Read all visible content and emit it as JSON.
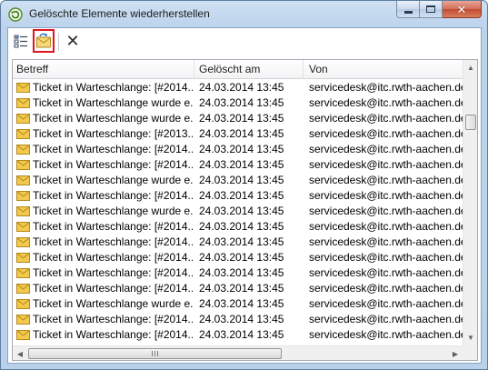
{
  "window": {
    "title": "Gelöschte Elemente wiederherstellen",
    "close_symbol": "✕"
  },
  "toolbar": {
    "select_icon": "select-all-icon",
    "restore_icon": "envelope-restore-icon",
    "delete_symbol": "✕"
  },
  "columns": [
    "Betreff",
    "Gelöscht am",
    "Von"
  ],
  "rows": [
    {
      "subject": "Ticket in Warteschlange: [#2014...",
      "deleted": "24.03.2014 13:45",
      "from": "servicedesk@itc.rwth-aachen.de"
    },
    {
      "subject": "Ticket in Warteschlange wurde e...",
      "deleted": "24.03.2014 13:45",
      "from": "servicedesk@itc.rwth-aachen.de"
    },
    {
      "subject": "Ticket in Warteschlange wurde e...",
      "deleted": "24.03.2014 13:45",
      "from": "servicedesk@itc.rwth-aachen.de"
    },
    {
      "subject": "Ticket in Warteschlange: [#2013...",
      "deleted": "24.03.2014 13:45",
      "from": "servicedesk@itc.rwth-aachen.de"
    },
    {
      "subject": "Ticket in Warteschlange: [#2014...",
      "deleted": "24.03.2014 13:45",
      "from": "servicedesk@itc.rwth-aachen.de"
    },
    {
      "subject": "Ticket in Warteschlange: [#2014...",
      "deleted": "24.03.2014 13:45",
      "from": "servicedesk@itc.rwth-aachen.de"
    },
    {
      "subject": "Ticket in Warteschlange wurde e...",
      "deleted": "24.03.2014 13:45",
      "from": "servicedesk@itc.rwth-aachen.de"
    },
    {
      "subject": "Ticket in Warteschlange: [#2014...",
      "deleted": "24.03.2014 13:45",
      "from": "servicedesk@itc.rwth-aachen.de"
    },
    {
      "subject": "Ticket in Warteschlange wurde e...",
      "deleted": "24.03.2014 13:45",
      "from": "servicedesk@itc.rwth-aachen.de"
    },
    {
      "subject": "Ticket in Warteschlange: [#2014...",
      "deleted": "24.03.2014 13:45",
      "from": "servicedesk@itc.rwth-aachen.de"
    },
    {
      "subject": "Ticket in Warteschlange: [#2014...",
      "deleted": "24.03.2014 13:45",
      "from": "servicedesk@itc.rwth-aachen.de"
    },
    {
      "subject": "Ticket in Warteschlange: [#2014...",
      "deleted": "24.03.2014 13:45",
      "from": "servicedesk@itc.rwth-aachen.de"
    },
    {
      "subject": "Ticket in Warteschlange: [#2014...",
      "deleted": "24.03.2014 13:45",
      "from": "servicedesk@itc.rwth-aachen.de"
    },
    {
      "subject": "Ticket in Warteschlange: [#2014...",
      "deleted": "24.03.2014 13:45",
      "from": "servicedesk@itc.rwth-aachen.de"
    },
    {
      "subject": "Ticket in Warteschlange wurde e...",
      "deleted": "24.03.2014 13:45",
      "from": "servicedesk@itc.rwth-aachen.de"
    },
    {
      "subject": "Ticket in Warteschlange: [#2014...",
      "deleted": "24.03.2014 13:45",
      "from": "servicedesk@itc.rwth-aachen.de"
    },
    {
      "subject": "Ticket in Warteschlange: [#2014...",
      "deleted": "24.03.2014 13:45",
      "from": "servicedesk@itc.rwth-aachen.de"
    },
    {
      "subject": "Ticket in Warteschlange: [#2014...",
      "deleted": "24.03.2014 13:45",
      "from": "servicedesk@itc.rwth-aachen.de"
    }
  ],
  "colors": {
    "restore_highlight": "#e0151f",
    "titlebar": "#bcd3ec",
    "envelope": "#f2c94c"
  }
}
